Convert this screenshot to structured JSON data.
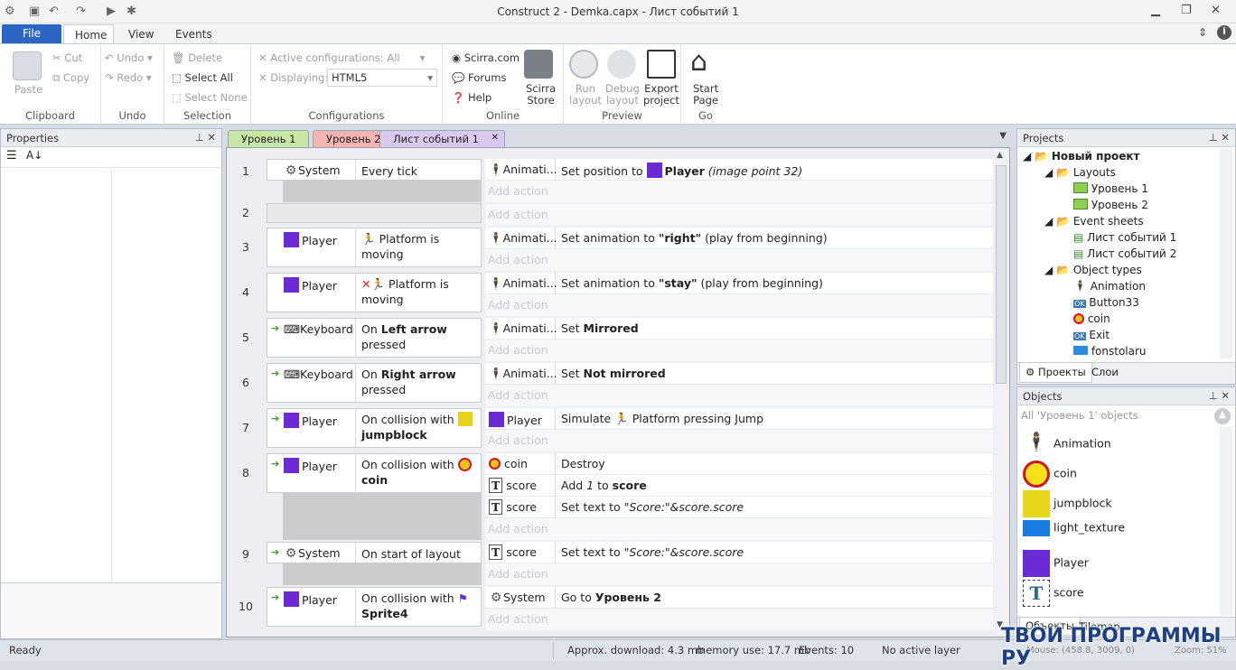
{
  "window": {
    "title": "Construct 2 - Demka.capx - Лист событий 1"
  },
  "ribbon_tabs": [
    "File",
    "Home",
    "View",
    "Events"
  ],
  "clipboard": {
    "paste": "Paste",
    "cut": "Cut",
    "copy": "Copy",
    "label": "Clipboard"
  },
  "undo": {
    "undo": "Undo",
    "redo": "Redo",
    "label": "Undo"
  },
  "selection": {
    "delete": "Delete",
    "select_all": "Select All",
    "select_none": "Select None",
    "label": "Selection"
  },
  "configurations": {
    "active": "Active configurations: All",
    "displaying_label": "Displaying:",
    "displaying_value": "HTML5",
    "label": "Configurations"
  },
  "online": {
    "scirra": "Scirra.com",
    "forums": "Forums",
    "help": "Help",
    "store1": "Scirra",
    "store2": "Store",
    "label": "Online"
  },
  "preview": {
    "run1": "Run",
    "run2": "layout",
    "debug1": "Debug",
    "debug2": "layout",
    "export1": "Export",
    "export2": "project",
    "label": "Preview"
  },
  "go": {
    "start1": "Start",
    "start2": "Page",
    "label": "Go"
  },
  "properties": {
    "title": "Properties"
  },
  "doc_tabs": [
    "Уровень 1",
    "Уровень 2",
    "Лист событий 1"
  ],
  "add_action": "Add action",
  "events": [
    {
      "n": "1",
      "obj": "System",
      "cond": "Every tick",
      "actions": [
        {
          "obj": "Animati...",
          "text": "Set position to ",
          "bold": "Player",
          "rest": " (image point 32)"
        }
      ]
    },
    {
      "n": "2",
      "obj": "",
      "cond": "",
      "actions": []
    },
    {
      "n": "3",
      "obj": "Player",
      "cond": "Platform is moving",
      "actions": [
        {
          "obj": "Animati...",
          "text": "Set animation to ",
          "bold": "\"right\"",
          "rest": " (play from beginning)"
        }
      ]
    },
    {
      "n": "4",
      "obj": "Player",
      "cond": "Platform is moving",
      "actions": [
        {
          "obj": "Animati...",
          "text": "Set animation to ",
          "bold": "\"stay\"",
          "rest": " (play from beginning)"
        }
      ]
    },
    {
      "n": "5",
      "obj": "Keyboard",
      "cond_a": "On ",
      "cond_b": "Left arrow",
      "cond_c": "pressed",
      "actions": [
        {
          "obj": "Animati...",
          "text": "Set ",
          "bold": "Mirrored",
          "rest": ""
        }
      ]
    },
    {
      "n": "6",
      "obj": "Keyboard",
      "cond_a": "On ",
      "cond_b": "Right arrow",
      "cond_c": "pressed",
      "actions": [
        {
          "obj": "Animati...",
          "text": "Set ",
          "bold": "Not mirrored",
          "rest": ""
        }
      ]
    },
    {
      "n": "7",
      "obj": "Player",
      "cond_a": "On collision with",
      "cond_b": "jumpblock",
      "actions": [
        {
          "obj": "Player",
          "text": "Simulate ",
          "bold": "",
          "rest": " Platform pressing Jump"
        }
      ]
    },
    {
      "n": "8",
      "obj": "Player",
      "cond_a": "On collision with",
      "cond_b": "coin",
      "actions": [
        {
          "obj": "coin",
          "text": "Destroy",
          "bold": "",
          "rest": ""
        },
        {
          "obj": "score",
          "text": "Add ",
          "italic": "1",
          "mid": " to ",
          "bold": "score",
          "rest": ""
        },
        {
          "obj": "score",
          "text": "Set text to ",
          "italic": "\"Score:\"&score.score",
          "bold": "",
          "rest": ""
        }
      ]
    },
    {
      "n": "9",
      "obj": "System",
      "cond": "On start of layout",
      "actions": [
        {
          "obj": "score",
          "text": "Set text to ",
          "italic": "\"Score:\"&score.score",
          "bold": "",
          "rest": ""
        }
      ]
    },
    {
      "n": "10",
      "obj": "Player",
      "cond_a": "On collision with",
      "cond_b": "Sprite4",
      "actions": [
        {
          "obj": "System",
          "text": "Go to ",
          "bold": "Уровень 2",
          "rest": ""
        }
      ]
    }
  ],
  "projects": {
    "title": "Projects",
    "root": "Новый проект",
    "layouts": "Layouts",
    "layout1": "Уровень 1",
    "layout2": "Уровень 2",
    "event_sheets": "Event sheets",
    "sheet1": "Лист событий 1",
    "sheet2": "Лист событий 2",
    "object_types": "Object types",
    "types": [
      "Animation",
      "Button33",
      "coin",
      "Exit",
      "fonstolaru"
    ],
    "tab1": "Проекты",
    "tab2": "Слои"
  },
  "objects": {
    "title": "Objects",
    "filter": "All 'Уровень 1' objects",
    "items": [
      "Animation",
      "coin",
      "jumpblock",
      "light_texture",
      "Player",
      "score"
    ],
    "tab1": "Объекты",
    "tab2": "Tilemap"
  },
  "status": {
    "ready": "Ready",
    "download": "Approx. download: 4.3 mb",
    "memory": "memory use: 17.7 mb",
    "events": "Events: 10",
    "layer": "No active layer",
    "mouse": "Mouse: (458.8, 3009, 0)",
    "zoom": "Zoom: 51%"
  },
  "watermark": "ТВОИ ПРОГРАММЫ РУ",
  "colors": {
    "file_tab": "#2b66c5",
    "player": "#6a2bd6",
    "tab_green": "#c8e6a4",
    "tab_red": "#f4b4b4",
    "tab_purple": "#d9c8f0"
  }
}
